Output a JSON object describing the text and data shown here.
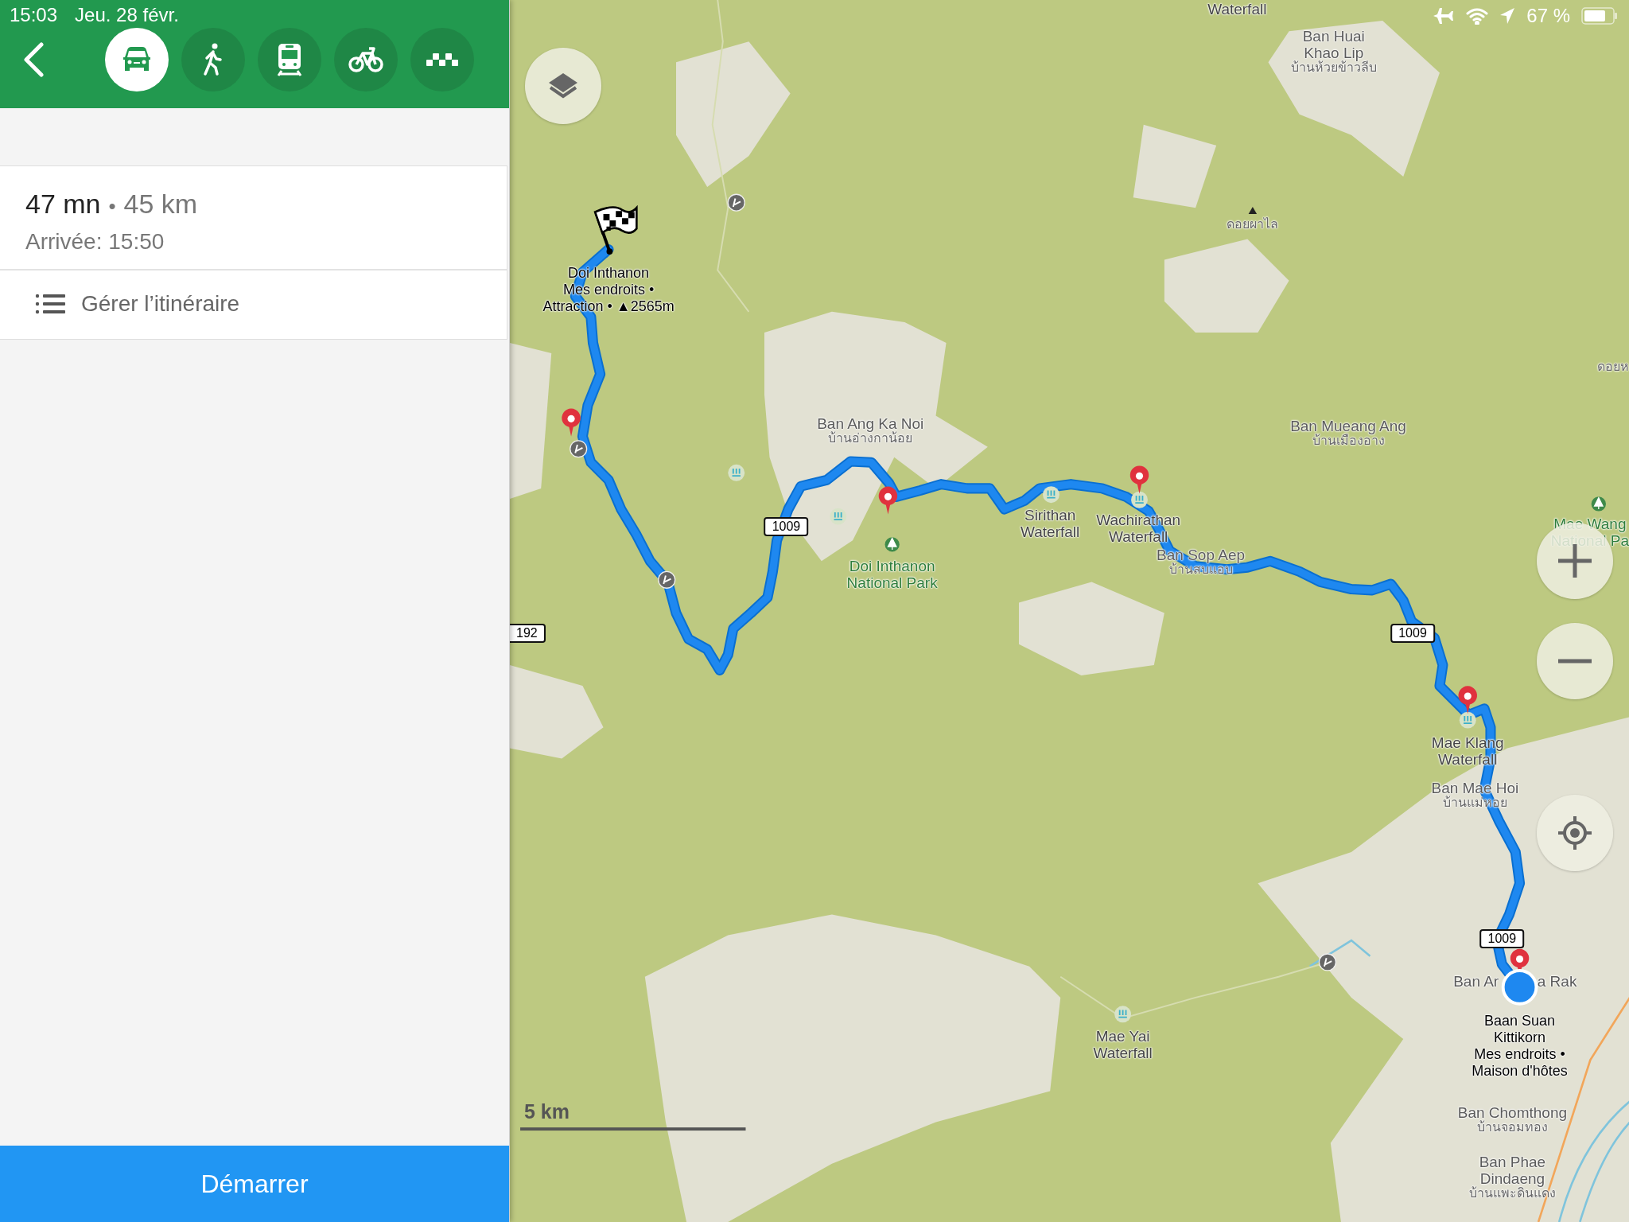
{
  "status_bar": {
    "time": "15:03",
    "date": "Jeu. 28 févr.",
    "battery": "67 %"
  },
  "header": {
    "modes": [
      {
        "kind": "car",
        "selected": true
      },
      {
        "kind": "walk",
        "selected": false
      },
      {
        "kind": "transit",
        "selected": false
      },
      {
        "kind": "bike",
        "selected": false
      },
      {
        "kind": "taxi",
        "selected": false
      }
    ]
  },
  "route_summary": {
    "duration": "47 mn",
    "separator": "•",
    "distance": "45 km",
    "arrival": "Arrivée: 15:50",
    "manage": "Gérer l’itinéraire"
  },
  "start_button": "Démarrer",
  "map": {
    "labels": [
      {
        "kind": "poi",
        "lines": [
          "Waterfall"
        ]
      },
      {
        "kind": "place",
        "lines": [
          "Ban Huai",
          "Khao Lip"
        ],
        "local": "บ้านห้วยข้าวลีบ"
      },
      {
        "kind": "peak",
        "local": "ดอยผาไล"
      },
      {
        "kind": "local",
        "local": "ดอยห"
      },
      {
        "kind": "favorite",
        "lines": [
          "Doi Inthanon",
          "Mes endroits •",
          "Attraction • ▲2565m"
        ]
      },
      {
        "kind": "place",
        "lines": [
          "Ban Ang Ka Noi"
        ],
        "local": "บ้านอ่างกาน้อย"
      },
      {
        "kind": "park",
        "lines": [
          "Doi Inthanon",
          "National Park"
        ]
      },
      {
        "kind": "poi",
        "lines": [
          "Sirithan",
          "Waterfall"
        ]
      },
      {
        "kind": "poi",
        "lines": [
          "Wachirathan",
          "Waterfall"
        ]
      },
      {
        "kind": "place",
        "lines": [
          "Ban Sop Aep"
        ],
        "local": "บ้านสบแอบ"
      },
      {
        "kind": "place",
        "lines": [
          "Ban Mueang Ang"
        ],
        "local": "บ้านเมืองอาง"
      },
      {
        "kind": "park",
        "lines": [
          "Mae Wang",
          "National Pa"
        ]
      },
      {
        "kind": "poi",
        "lines": [
          "Mae Klang",
          "Waterfall"
        ]
      },
      {
        "kind": "place",
        "lines": [
          "Ban Mae Hoi"
        ],
        "local": "บ้านแม่หอย"
      },
      {
        "kind": "place",
        "lines": [
          "Ban Ar"
        ]
      },
      {
        "kind": "place",
        "lines": [
          "a Rak"
        ]
      },
      {
        "kind": "favorite",
        "lines": [
          "Baan Suan",
          "Kittikorn",
          "Mes endroits •",
          "Maison d'hôtes"
        ]
      },
      {
        "kind": "place",
        "lines": [
          "Ban Chomthong"
        ],
        "local": "บ้านจอมทอง"
      },
      {
        "kind": "place",
        "lines": [
          "Ban Phae",
          "Dindaeng"
        ],
        "local": "บ้านแพะดินแดง"
      },
      {
        "kind": "poi",
        "lines": [
          "Mae Yai",
          "Waterfall"
        ]
      }
    ],
    "road_shields": [
      "1009",
      "1009",
      "1009",
      "192"
    ],
    "scale": "5 km"
  }
}
